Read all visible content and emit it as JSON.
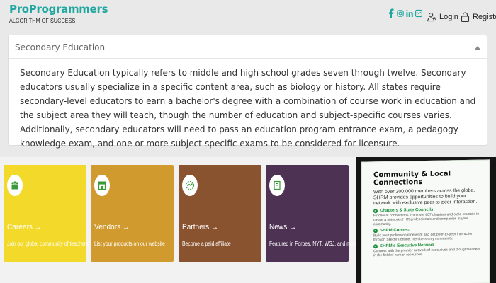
{
  "brand": {
    "name": "ProProgrammers",
    "tagline": "ALGORITHM OF SUCCESS",
    "color": "#1fa7a0"
  },
  "social_icons": [
    "facebook-icon",
    "instagram-icon",
    "linkedin-icon",
    "email-icon"
  ],
  "nav": {
    "login": "Login",
    "register": "Register"
  },
  "panel": {
    "title": "Secondary Education",
    "body": "Secondary Education typically refers to middle and high school grades seven through twelve. Secondary educators usually specialize in a specific content area, such as biology or history. All states require secondary-level educators to earn a bachelor's degree with a combination of course work in education and the subject area they will teach, though the number of education and subject-specific courses varies. Additionally, secondary educators will need to pass an education program entrance exam, a pedagogy knowledge exam, and one or more subject-specific exams to be considered for licensure."
  },
  "cards": [
    {
      "title": "Careers",
      "arrow": "→",
      "desc": "Join our global community of teachers",
      "color": "#f2d92a",
      "icon": "people-icon"
    },
    {
      "title": "Vendors",
      "arrow": "→",
      "desc": "List your products on our website",
      "color": "#d19a2e",
      "icon": "store-icon"
    },
    {
      "title": "Partners",
      "arrow": "→",
      "desc": "Become a paid affiliate",
      "color": "#8a5330",
      "icon": "handshake-icon"
    },
    {
      "title": "News",
      "arrow": "→",
      "desc": "Featured in Forbes, NYT, WSJ, and more",
      "color": "#4d3254",
      "icon": "newspaper-icon"
    }
  ],
  "promo": {
    "title": "Community & Local Connections",
    "intro": "With over 300,000 members across the globe, SHRM provides opportunities to build your network with exclusive peer-to-peer interaction.",
    "items": [
      {
        "title": "Chapters & State Councils",
        "text": "Find local connections from over 607 chapters and state councils to create a network of HR professionals and companies in your community."
      },
      {
        "title": "SHRM Connect",
        "text": "Build your professional network and get peer-to-peer interaction through SHRM's online, members-only community."
      },
      {
        "title": "SHRM's Executive Network",
        "text": "Connect with the premier network of executives and thought leaders in the field of human resources."
      }
    ],
    "accent": "#1b8c3a"
  }
}
